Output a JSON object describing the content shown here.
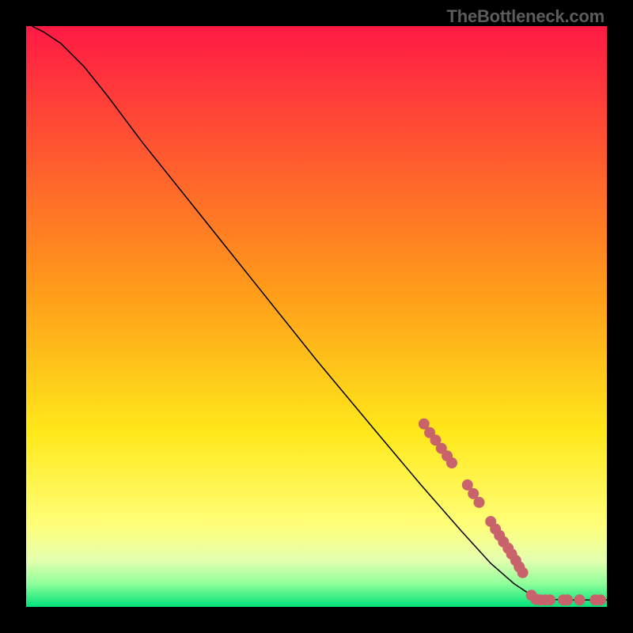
{
  "watermark": "TheBottleneck.com",
  "chart_data": {
    "type": "line",
    "title": "",
    "xlabel": "",
    "ylabel": "",
    "xlim": [
      0,
      100
    ],
    "ylim": [
      0,
      100
    ],
    "gradient_stops": [
      {
        "offset": 0,
        "color": "#ff1a44"
      },
      {
        "offset": 45,
        "color": "#ff9a1a"
      },
      {
        "offset": 70,
        "color": "#ffe81a"
      },
      {
        "offset": 86,
        "color": "#ffff7a"
      },
      {
        "offset": 92,
        "color": "#e4ffb0"
      },
      {
        "offset": 96,
        "color": "#8fff9a"
      },
      {
        "offset": 100,
        "color": "#00e27a"
      }
    ],
    "series": [
      {
        "name": "curve",
        "type": "line",
        "color": "#000000",
        "width": 1.5,
        "points": [
          {
            "x": 1.0,
            "y": 100.0
          },
          {
            "x": 3.0,
            "y": 99.0
          },
          {
            "x": 6.0,
            "y": 97.0
          },
          {
            "x": 10.0,
            "y": 93.0
          },
          {
            "x": 14.0,
            "y": 88.0
          },
          {
            "x": 20.0,
            "y": 80.0
          },
          {
            "x": 30.0,
            "y": 67.5
          },
          {
            "x": 40.0,
            "y": 55.0
          },
          {
            "x": 50.0,
            "y": 42.5
          },
          {
            "x": 60.0,
            "y": 30.5
          },
          {
            "x": 68.0,
            "y": 21.0
          },
          {
            "x": 75.0,
            "y": 13.0
          },
          {
            "x": 80.0,
            "y": 7.5
          },
          {
            "x": 84.0,
            "y": 4.0
          },
          {
            "x": 87.0,
            "y": 2.0
          },
          {
            "x": 90.0,
            "y": 1.3
          },
          {
            "x": 94.0,
            "y": 1.2
          },
          {
            "x": 100.0,
            "y": 1.2
          }
        ]
      },
      {
        "name": "markers",
        "type": "scatter",
        "color": "#c9636b",
        "radius": 7,
        "points": [
          {
            "x": 68.5,
            "y": 31.5
          },
          {
            "x": 69.5,
            "y": 30.0
          },
          {
            "x": 70.5,
            "y": 28.7
          },
          {
            "x": 71.5,
            "y": 27.3
          },
          {
            "x": 72.5,
            "y": 26.0
          },
          {
            "x": 73.3,
            "y": 24.8
          },
          {
            "x": 76.0,
            "y": 21.0
          },
          {
            "x": 77.0,
            "y": 19.5
          },
          {
            "x": 78.0,
            "y": 18.0
          },
          {
            "x": 80.0,
            "y": 14.7
          },
          {
            "x": 80.8,
            "y": 13.4
          },
          {
            "x": 81.5,
            "y": 12.3
          },
          {
            "x": 82.2,
            "y": 11.2
          },
          {
            "x": 83.0,
            "y": 10.1
          },
          {
            "x": 83.6,
            "y": 9.1
          },
          {
            "x": 84.3,
            "y": 8.0
          },
          {
            "x": 84.9,
            "y": 6.9
          },
          {
            "x": 85.5,
            "y": 5.9
          },
          {
            "x": 87.0,
            "y": 2.0
          },
          {
            "x": 87.8,
            "y": 1.3
          },
          {
            "x": 88.6,
            "y": 1.2
          },
          {
            "x": 89.4,
            "y": 1.2
          },
          {
            "x": 90.2,
            "y": 1.2
          },
          {
            "x": 92.5,
            "y": 1.2
          },
          {
            "x": 93.2,
            "y": 1.2
          },
          {
            "x": 95.3,
            "y": 1.2
          },
          {
            "x": 98.0,
            "y": 1.2
          },
          {
            "x": 98.9,
            "y": 1.2
          }
        ]
      }
    ]
  }
}
